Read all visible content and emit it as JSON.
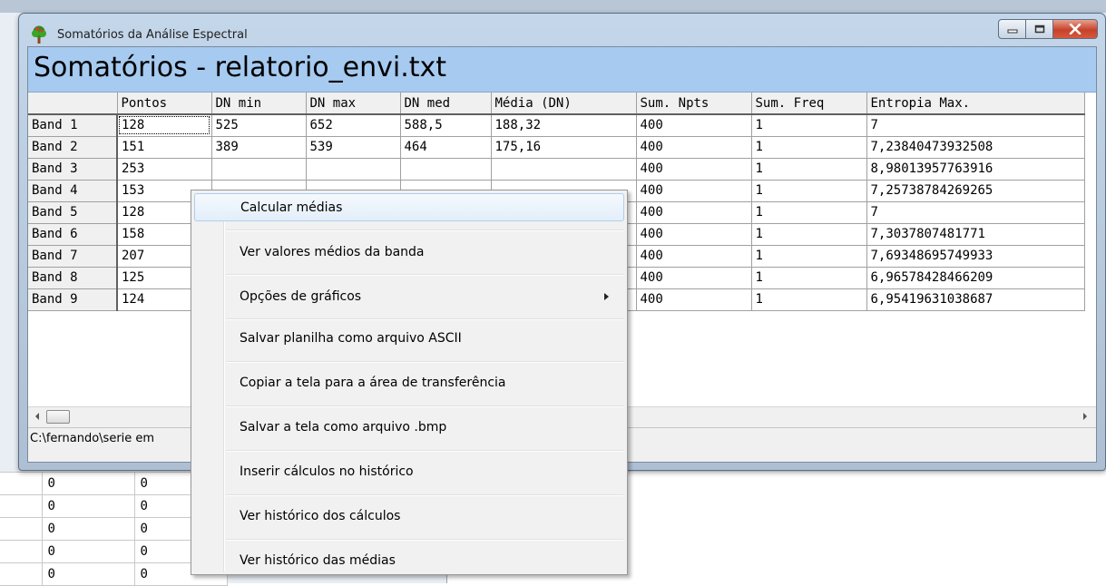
{
  "window": {
    "title": "Somatórios da Análise Espectral",
    "header": "Somatórios - relatorio_envi.txt"
  },
  "grid": {
    "columns": [
      "",
      "Pontos",
      "DN min",
      "DN max",
      "DN med",
      "Média (DN)",
      "Sum. Npts",
      "Sum. Freq",
      "Entropia Max."
    ],
    "rows": [
      [
        "Band 1",
        "128",
        "525",
        "652",
        "588,5",
        "188,32",
        "400",
        "1",
        "7"
      ],
      [
        "Band 2",
        "151",
        "389",
        "539",
        "464",
        "175,16",
        "400",
        "1",
        "7,23840473932508"
      ],
      [
        "Band 3",
        "253",
        "",
        "",
        "",
        "",
        "400",
        "1",
        "8,98013957763916"
      ],
      [
        "Band 4",
        "153",
        "",
        "",
        "",
        "",
        "400",
        "1",
        "7,25738784269265"
      ],
      [
        "Band 5",
        "128",
        "",
        "",
        "",
        "",
        "400",
        "1",
        "7"
      ],
      [
        "Band 6",
        "158",
        "",
        "",
        "",
        "",
        "400",
        "1",
        "7,3037807481771"
      ],
      [
        "Band 7",
        "207",
        "",
        "",
        "",
        "",
        "400",
        "1",
        "7,69348695749933"
      ],
      [
        "Band 8",
        "125",
        "",
        "",
        "",
        "",
        "400",
        "1",
        "6,96578428466209"
      ],
      [
        "Band 9",
        "124",
        "",
        "",
        "",
        "",
        "400",
        "1",
        "6,95419631038687"
      ]
    ]
  },
  "status": {
    "path": "C:\\fernando\\serie em"
  },
  "background_grid": {
    "rows": [
      [
        "0",
        "0"
      ],
      [
        "0",
        "0"
      ],
      [
        "0",
        "0"
      ],
      [
        "0",
        "0"
      ],
      [
        "0",
        "0"
      ]
    ]
  },
  "context_menu": {
    "items": [
      {
        "label": "Calcular médias",
        "highlighted": true
      },
      {
        "label": "Ver valores médios da banda"
      },
      {
        "label": "Opções de gráficos",
        "submenu": true
      },
      {
        "label": "Salvar planilha como arquivo ASCII"
      },
      {
        "label": "Copiar a tela para a área de transferência"
      },
      {
        "label": "Salvar a tela como arquivo .bmp"
      },
      {
        "label": "Inserir cálculos no histórico"
      },
      {
        "label": "Ver histórico dos cálculos"
      },
      {
        "label": "Ver histórico das médias"
      }
    ]
  },
  "icons": {
    "app": "tree-icon",
    "scroll_left": "chevron-left-icon",
    "scroll_right": "chevron-right-icon",
    "submenu": "chevron-right-icon"
  },
  "colors": {
    "header_panel": "#a6caf0",
    "close_button": "#c6422a",
    "menu_highlight": "#e3eefa"
  }
}
